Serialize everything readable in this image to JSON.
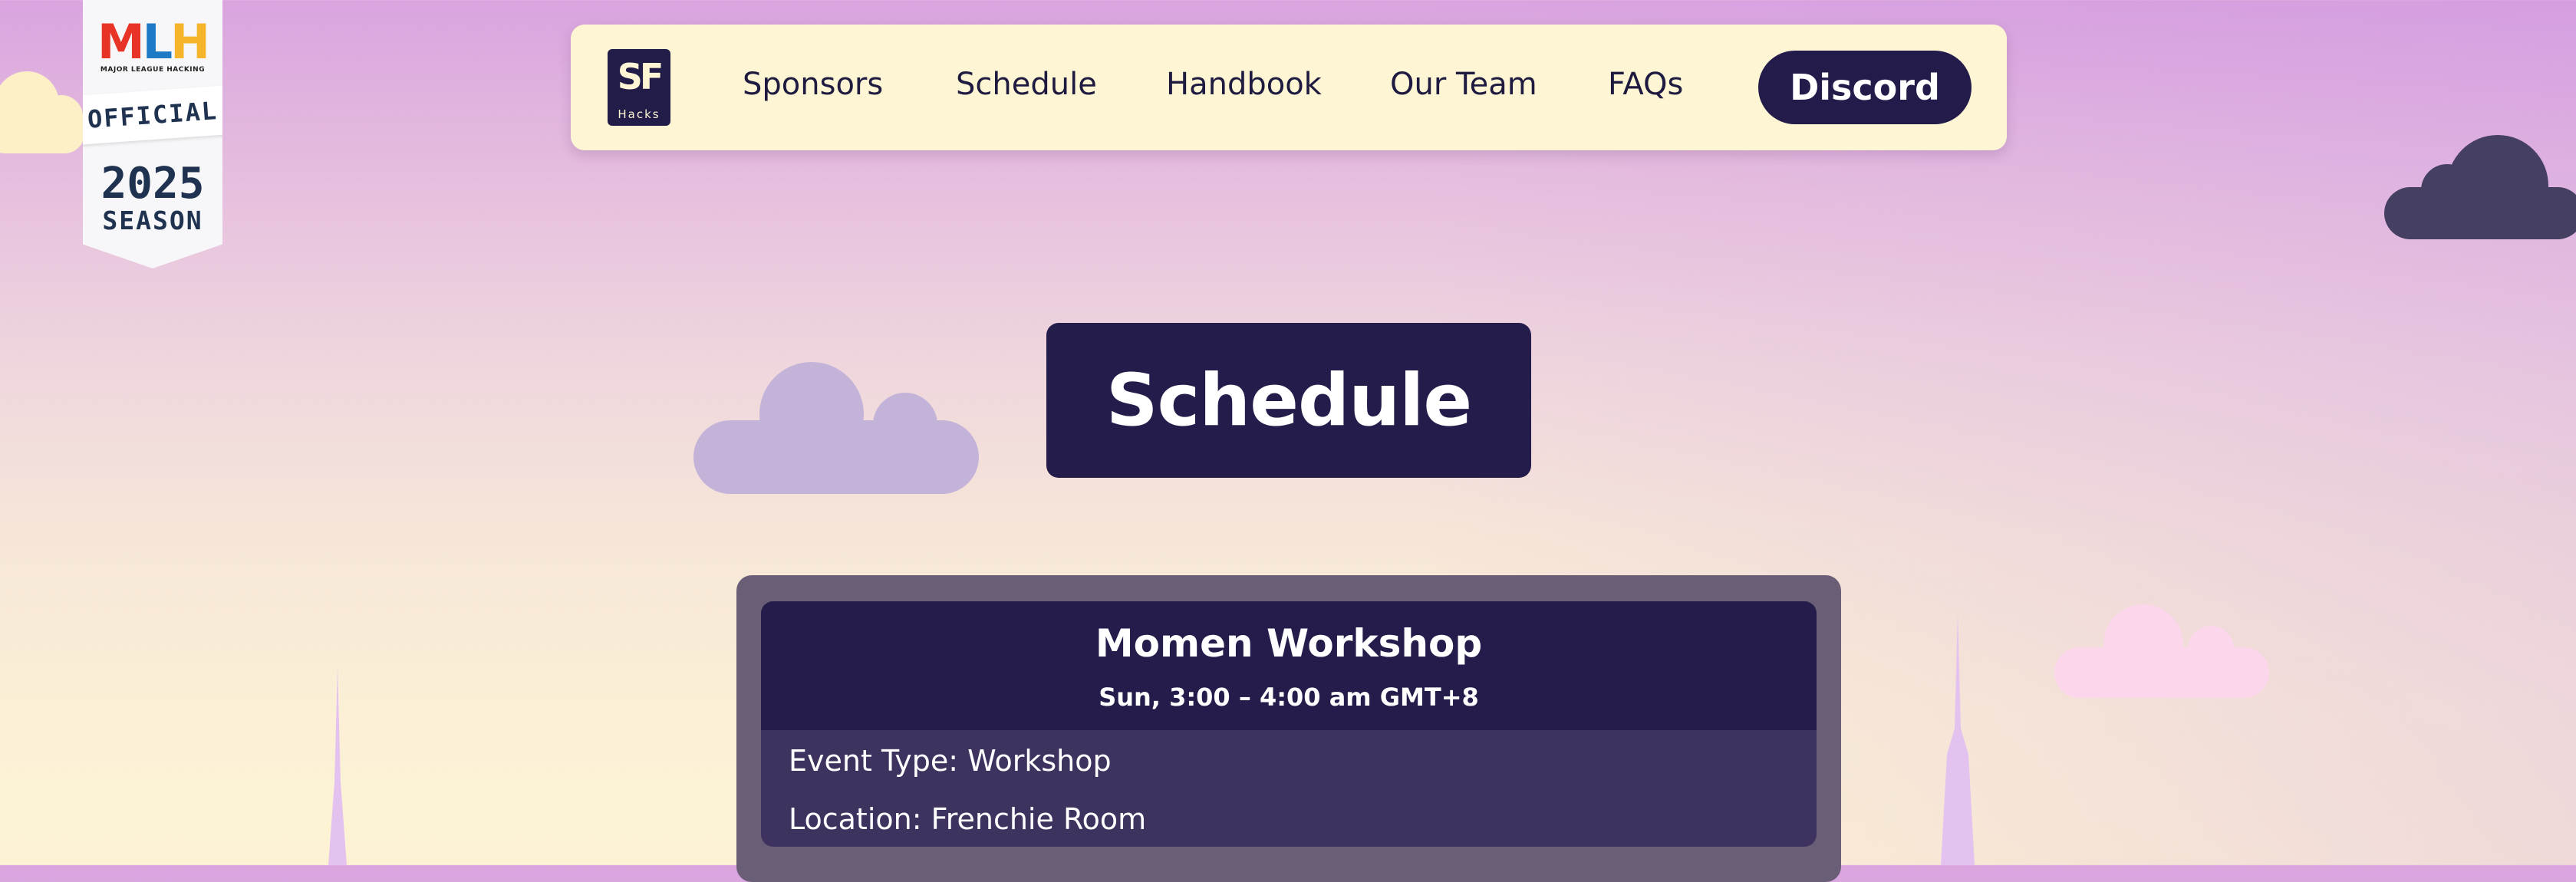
{
  "mlh_badge": {
    "logo": {
      "m": "M",
      "l": "L",
      "h": "H"
    },
    "subtitle": "MAJOR LEAGUE HACKING",
    "ribbon": "OFFICIAL",
    "year": "2025",
    "season": "SEASON"
  },
  "nav": {
    "logo": {
      "mark": "SF",
      "text": "Hacks"
    },
    "links": [
      "Sponsors",
      "Schedule",
      "Handbook",
      "Our Team",
      "FAQs"
    ],
    "cta": "Discord"
  },
  "page": {
    "title": "Schedule"
  },
  "event": {
    "title": "Momen Workshop",
    "time": "Sun, 3:00 – 4:00 am GMT+8",
    "type": "Event Type: Workshop",
    "location": "Location: Frenchie Room"
  },
  "colors": {
    "navy": "#241d4b",
    "cream": "#fdf5d3",
    "card_outer": "#6a5e77",
    "card_body": "#3d335e"
  }
}
